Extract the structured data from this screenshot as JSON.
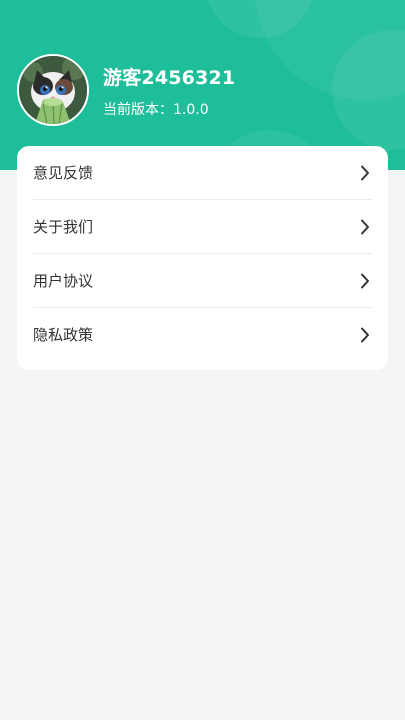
{
  "profile": {
    "username": "游客2456321",
    "version_text": "当前版本：1.0.0"
  },
  "menu": {
    "items": [
      {
        "label": "意见反馈"
      },
      {
        "label": "关于我们"
      },
      {
        "label": "用户协议"
      },
      {
        "label": "隐私政策"
      }
    ]
  },
  "colors": {
    "header_bg": "#1fbe9a",
    "page_bg": "#f5f5f5",
    "card_bg": "#ffffff",
    "text_primary": "#333333"
  },
  "icons": {
    "avatar": "cat-avatar-image",
    "chevron": "chevron-right-icon"
  }
}
